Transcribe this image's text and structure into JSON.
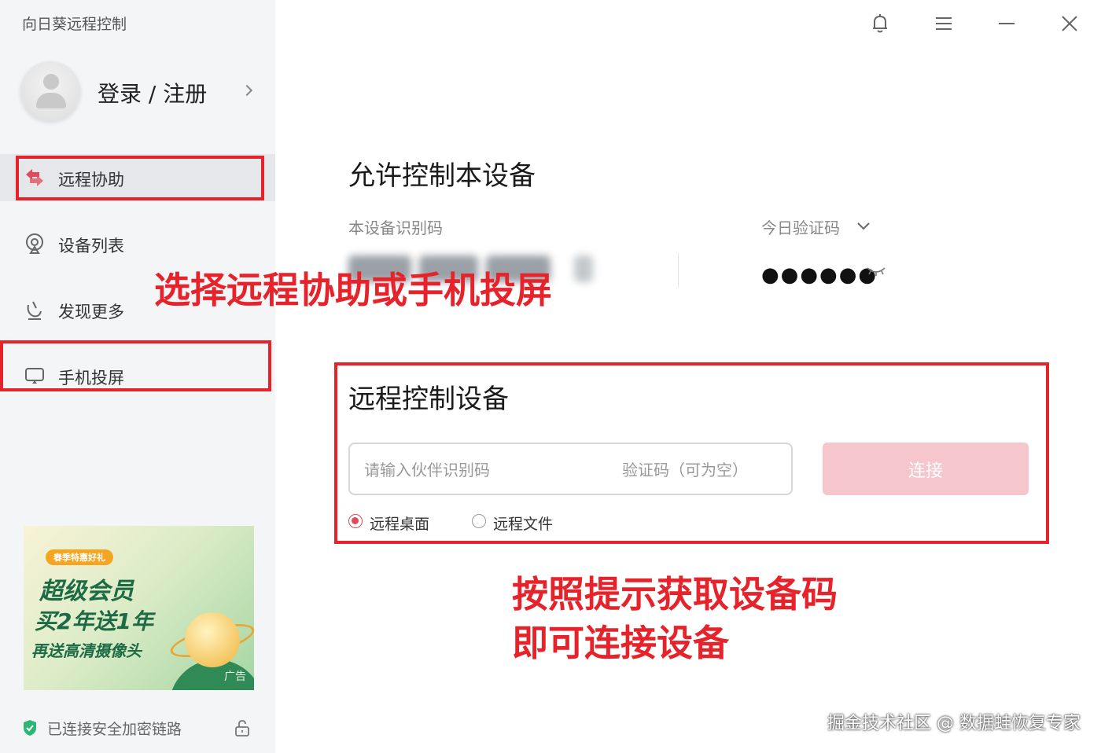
{
  "app": {
    "title": "向日葵远程控制"
  },
  "account": {
    "label": "登录 / 注册"
  },
  "nav": {
    "items": [
      {
        "label": "远程协助",
        "icon": "remote-assist-icon",
        "active": true
      },
      {
        "label": "设备列表",
        "icon": "device-list-icon",
        "active": false
      },
      {
        "label": "发现更多",
        "icon": "discover-icon",
        "active": false
      },
      {
        "label": "手机投屏",
        "icon": "screen-cast-icon",
        "active": false
      }
    ]
  },
  "allow_control": {
    "title": "允许控制本设备",
    "device_id_label": "本设备识别码",
    "verify_code_label": "今日验证码",
    "verify_code_masked": "●●●●●●"
  },
  "remote_control": {
    "title": "远程控制设备",
    "partner_id_placeholder": "请输入伙伴识别码",
    "verify_placeholder": "验证码（可为空）",
    "connect_label": "连接",
    "modes": [
      {
        "label": "远程桌面",
        "selected": true
      },
      {
        "label": "远程文件",
        "selected": false
      }
    ]
  },
  "ad": {
    "tag": "春季特惠好礼",
    "line1": "超级会员",
    "line2": "买2年送1年",
    "line3": "再送高清摄像头",
    "label": "广告"
  },
  "status": {
    "secure_text": "已连接安全加密链路"
  },
  "annotations": {
    "nav_hint": "选择远程协助或手机投屏",
    "connect_hint_1": "按照提示获取设备码",
    "connect_hint_2": "即可连接设备"
  },
  "watermark": "掘金技术社区 @ 数据蛙恢复专家",
  "colors": {
    "highlight": "#e6232b",
    "accent": "#e04a5a",
    "connect_disabled": "#f5c6cc",
    "secure": "#2bb673"
  }
}
